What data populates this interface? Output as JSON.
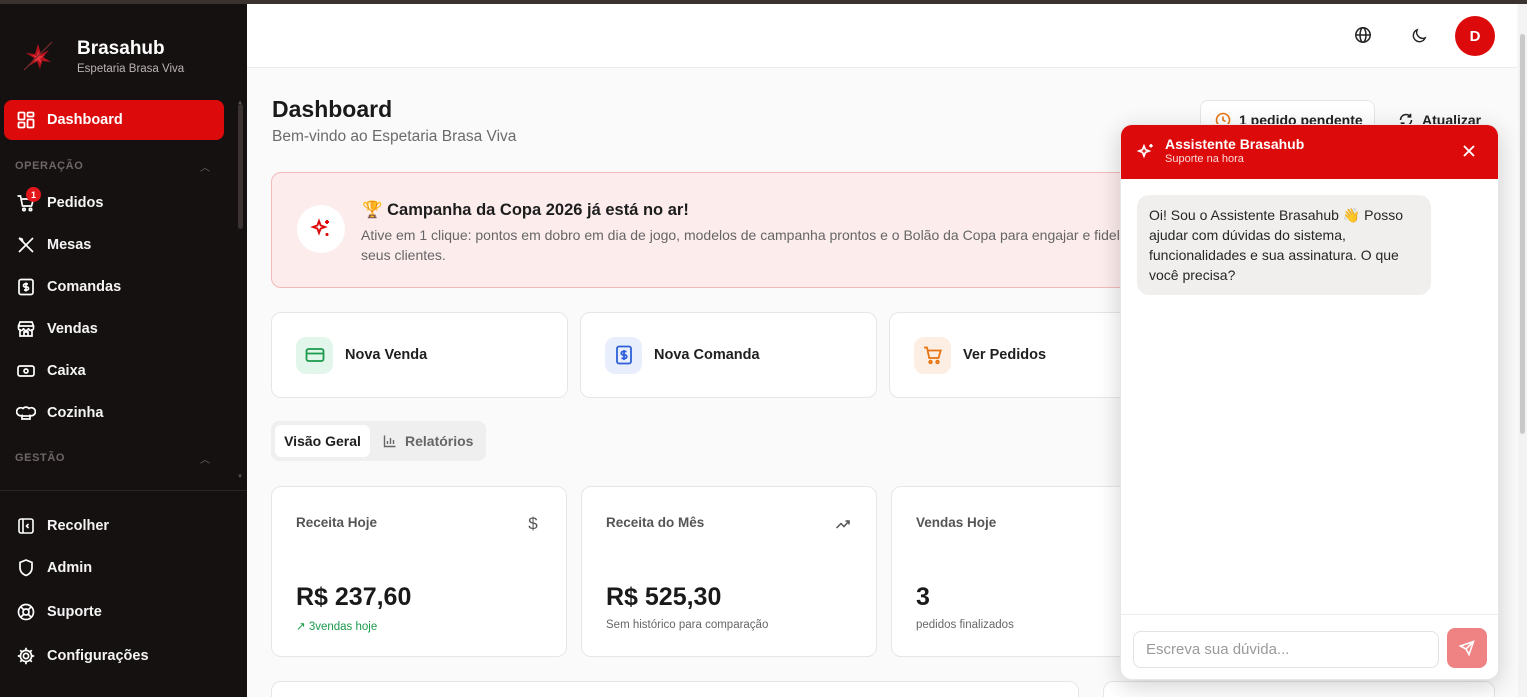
{
  "brand": {
    "title": "Brasahub",
    "subtitle": "Espetaria Brasa Viva"
  },
  "sidebar": {
    "active": {
      "label": "Dashboard",
      "icon": "dashboard-grid-icon"
    },
    "sections": [
      {
        "label": "OPERAÇÃO"
      },
      {
        "label": "GESTÃO"
      }
    ],
    "items": [
      {
        "label": "Pedidos",
        "icon": "cart-icon",
        "badge": "1"
      },
      {
        "label": "Mesas",
        "icon": "utensils-icon"
      },
      {
        "label": "Comandas",
        "icon": "receipt-icon"
      },
      {
        "label": "Vendas",
        "icon": "store-icon"
      },
      {
        "label": "Caixa",
        "icon": "cash-icon"
      },
      {
        "label": "Cozinha",
        "icon": "chef-hat-icon"
      }
    ],
    "footer": [
      {
        "label": "Recolher",
        "icon": "collapse-icon"
      },
      {
        "label": "Admin",
        "icon": "shield-icon"
      },
      {
        "label": "Suporte",
        "icon": "lifebuoy-icon"
      },
      {
        "label": "Configurações",
        "icon": "gear-icon"
      }
    ]
  },
  "topbar": {
    "avatar_initial": "D"
  },
  "header": {
    "title": "Dashboard",
    "subtitle": "Bem-vindo ao Espetaria Brasa Viva",
    "pending_label": "1 pedido pendente",
    "refresh_label": "Atualizar"
  },
  "banner": {
    "title": "🏆 Campanha da Copa 2026 já está no ar!",
    "text": "Ative em 1 clique: pontos em dobro em dia de jogo, modelos de campanha prontos e o Bolão da Copa para engajar e fidel seus clientes."
  },
  "quick_actions": [
    {
      "label": "Nova Venda",
      "icon": "credit-card-icon"
    },
    {
      "label": "Nova Comanda",
      "icon": "receipt-dollar-icon"
    },
    {
      "label": "Ver Pedidos",
      "icon": "shopping-cart-icon"
    }
  ],
  "tabs": [
    {
      "label": "Visão Geral"
    },
    {
      "label": "Relatórios"
    }
  ],
  "stats": [
    {
      "label": "Receita Hoje",
      "value": "R$ 237,60",
      "note": "↗ 3vendas hoje"
    },
    {
      "label": "Receita do Mês",
      "value": "R$ 525,30",
      "note": "Sem histórico para comparação"
    },
    {
      "label": "Vendas Hoje",
      "value": "3",
      "note": "pedidos finalizados"
    }
  ],
  "chat": {
    "title": "Assistente Brasahub",
    "subtitle": "Suporte na hora",
    "message": "Oi! Sou o Assistente Brasahub 👋 Posso ajudar com dúvidas do sistema, funcionalidades e sua assinatura. O que você precisa?",
    "input_placeholder": "Escreva sua dúvida..."
  },
  "colors": {
    "accent": "#dc0a0a",
    "sidebar_bg": "#161111",
    "banner_bg": "#fcecec"
  }
}
